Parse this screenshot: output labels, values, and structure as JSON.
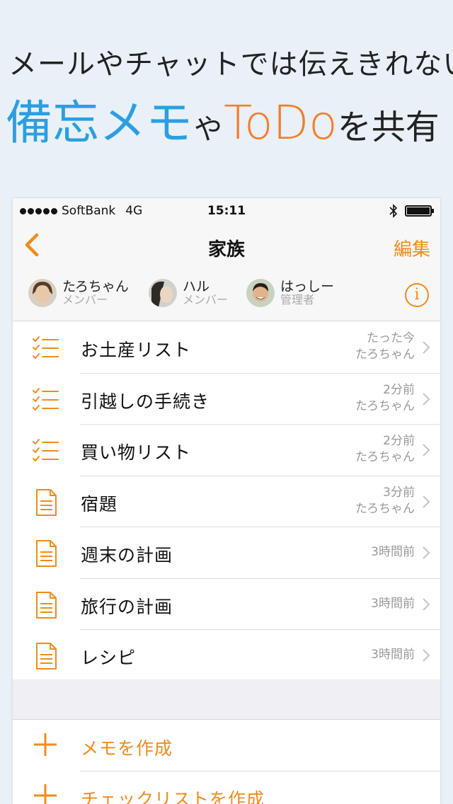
{
  "promo": {
    "line1": "メールやチャットでは伝えきれない",
    "memo": "備忘メモ",
    "ya": "や",
    "todo": "ToDo",
    "share": "を共有"
  },
  "status_bar": {
    "carrier": "SoftBank",
    "network": "4G",
    "time": "15:11"
  },
  "nav": {
    "title": "家族",
    "edit": "編集"
  },
  "members": [
    {
      "name": "たろちゃん",
      "role": "メンバー"
    },
    {
      "name": "ハル",
      "role": "メンバー"
    },
    {
      "name": "はっしー",
      "role": "管理者"
    }
  ],
  "items": [
    {
      "icon": "checklist-icon",
      "title": "お土産リスト",
      "time": "たった今",
      "author": "たろちゃん"
    },
    {
      "icon": "checklist-icon",
      "title": "引越しの手続き",
      "time": "2分前",
      "author": "たろちゃん"
    },
    {
      "icon": "checklist-icon",
      "title": "買い物リスト",
      "time": "2分前",
      "author": "たろちゃん"
    },
    {
      "icon": "memo-icon",
      "title": "宿題",
      "time": "3分前",
      "author": "たろちゃん"
    },
    {
      "icon": "memo-icon",
      "title": "週末の計画",
      "time": "3時間前"
    },
    {
      "icon": "memo-icon",
      "title": "旅行の計画",
      "time": "3時間前"
    },
    {
      "icon": "memo-icon",
      "title": "レシピ",
      "time": "3時間前"
    }
  ],
  "actions": {
    "create_memo": "メモを作成",
    "create_checklist": "チェックリストを作成"
  },
  "colors": {
    "accent": "#f28b1b",
    "promo_blue": "#2a9fe2",
    "promo_orange": "#f57d28"
  }
}
